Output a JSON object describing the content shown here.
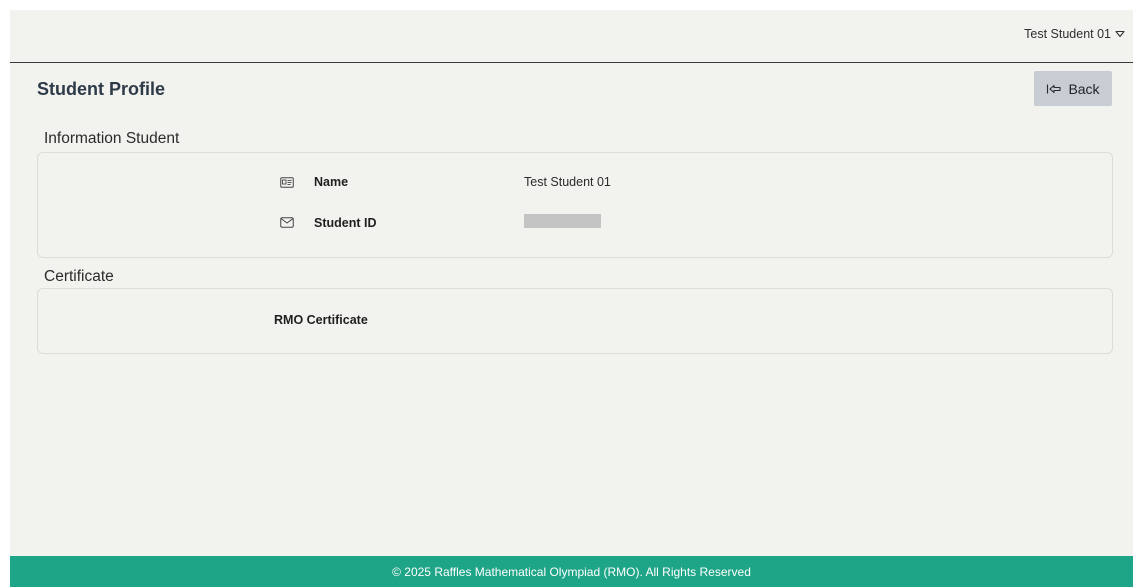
{
  "header": {
    "user_name": "Test Student 01"
  },
  "page": {
    "title": "Student Profile",
    "back_label": "Back"
  },
  "information_section": {
    "heading": "Information Student",
    "rows": [
      {
        "icon": "id-card-icon",
        "label": "Name",
        "value": "Test Student 01"
      },
      {
        "icon": "envelope-icon",
        "label": "Student ID",
        "value": ""
      }
    ]
  },
  "certificate_section": {
    "heading": "Certificate",
    "item_label": "RMO Certificate"
  },
  "footer": {
    "text": "© 2025 Raffles Mathematical Olympiad (RMO). All Rights Reserved"
  },
  "colors": {
    "background": "#f2f2ef",
    "footer": "#1ea486",
    "back_button": "#c8ccd3",
    "title_text": "#2d3a48"
  }
}
